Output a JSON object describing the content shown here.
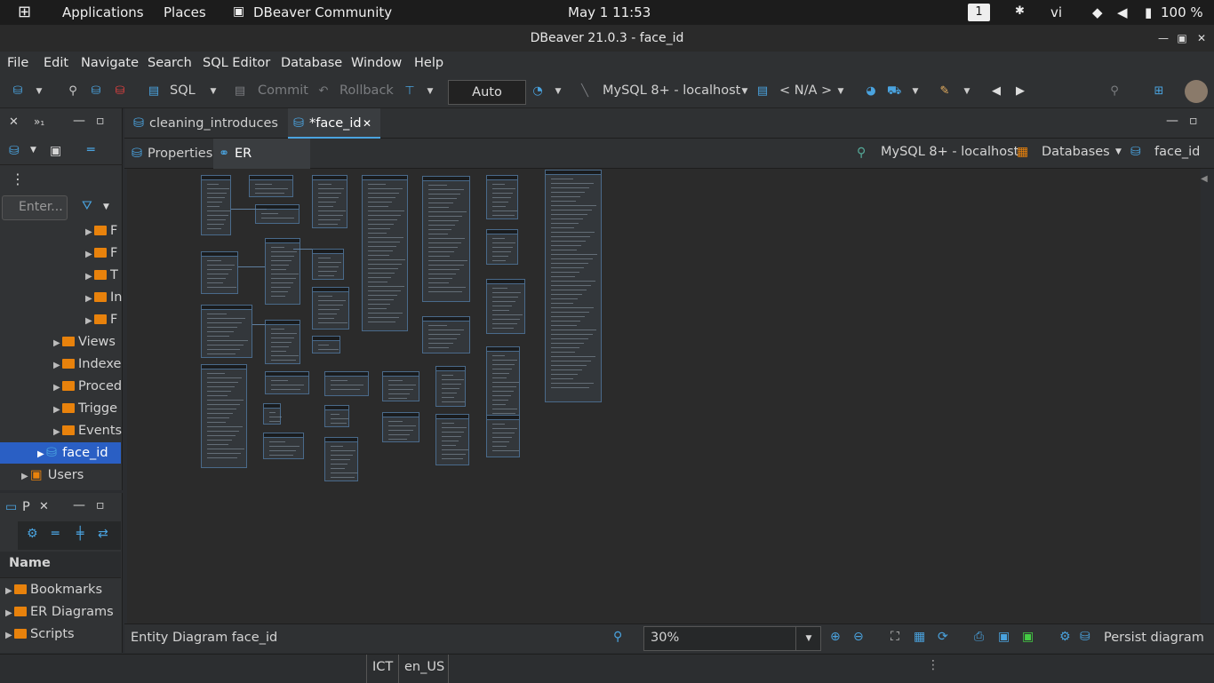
{
  "system_bar": {
    "applications": "Applications",
    "places": "Places",
    "active_app": "DBeaver Community",
    "datetime": "May 1  11:53",
    "workspace": "1",
    "keyboard": "vi",
    "battery": "100 %"
  },
  "window": {
    "title": "DBeaver 21.0.3 - face_id"
  },
  "menu": [
    "File",
    "Edit",
    "Navigate",
    "Search",
    "SQL Editor",
    "Database",
    "Window",
    "Help"
  ],
  "toolbar": {
    "sql_label": "SQL",
    "commit_label": "Commit",
    "rollback_label": "Rollback",
    "transaction_mode": "Auto",
    "connection": "MySQL 8+ - localhost",
    "schema": "< N/A >"
  },
  "navigator": {
    "filter_placeholder": "Enter...",
    "tree": [
      {
        "label": "F",
        "indent": 3
      },
      {
        "label": "F",
        "indent": 3
      },
      {
        "label": "T",
        "indent": 3
      },
      {
        "label": "In",
        "indent": 3
      },
      {
        "label": "F",
        "indent": 3
      },
      {
        "label": "Views",
        "indent": 2
      },
      {
        "label": "Indexe",
        "indent": 2
      },
      {
        "label": "Proced",
        "indent": 2
      },
      {
        "label": "Trigge",
        "indent": 2
      },
      {
        "label": "Events",
        "indent": 2
      },
      {
        "label": "face_id",
        "indent": 1,
        "selected": true
      },
      {
        "label": "Users",
        "indent": 1
      }
    ]
  },
  "projects": {
    "tab_label": "P",
    "header": "Name",
    "items": [
      "Bookmarks",
      "ER Diagrams",
      "Scripts"
    ]
  },
  "editor_tabs": [
    {
      "label": "cleaning_introduces",
      "active": false
    },
    {
      "label": "*face_id",
      "active": true
    }
  ],
  "sub_tabs": {
    "properties": "Properties",
    "er_diagram": "ER Diagram",
    "conn_label": "MySQL 8+ - localhost",
    "databases": "Databases",
    "db_name": "face_id"
  },
  "diagram_status": {
    "label": "Entity Diagram  face_id",
    "zoom": "30%",
    "persist": "Persist diagram"
  },
  "bottom_bar": {
    "tz": "ICT",
    "locale": "en_US"
  }
}
